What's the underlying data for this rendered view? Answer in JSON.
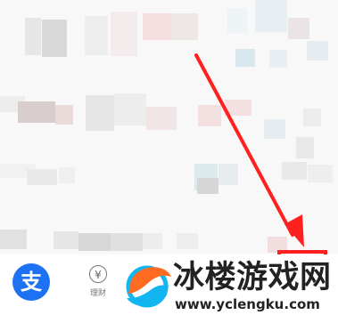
{
  "bottom_nav": {
    "alipay_label": "支",
    "licai_icon_text": "¥",
    "licai_label": "理财"
  },
  "watermark": {
    "title": "冰楼游戏网",
    "url": "www.yclengku.com"
  },
  "colors": {
    "annotation_red": "#ff2020",
    "alipay_blue": "#1d72f3",
    "watermark_blue": "#12b5ef",
    "watermark_orange": "#ff6b21"
  },
  "icons": {
    "alipay_tab": "alipay-logo-icon",
    "licai_tab": "currency-coin-icon",
    "watermark": "swirl-logo-icon"
  }
}
